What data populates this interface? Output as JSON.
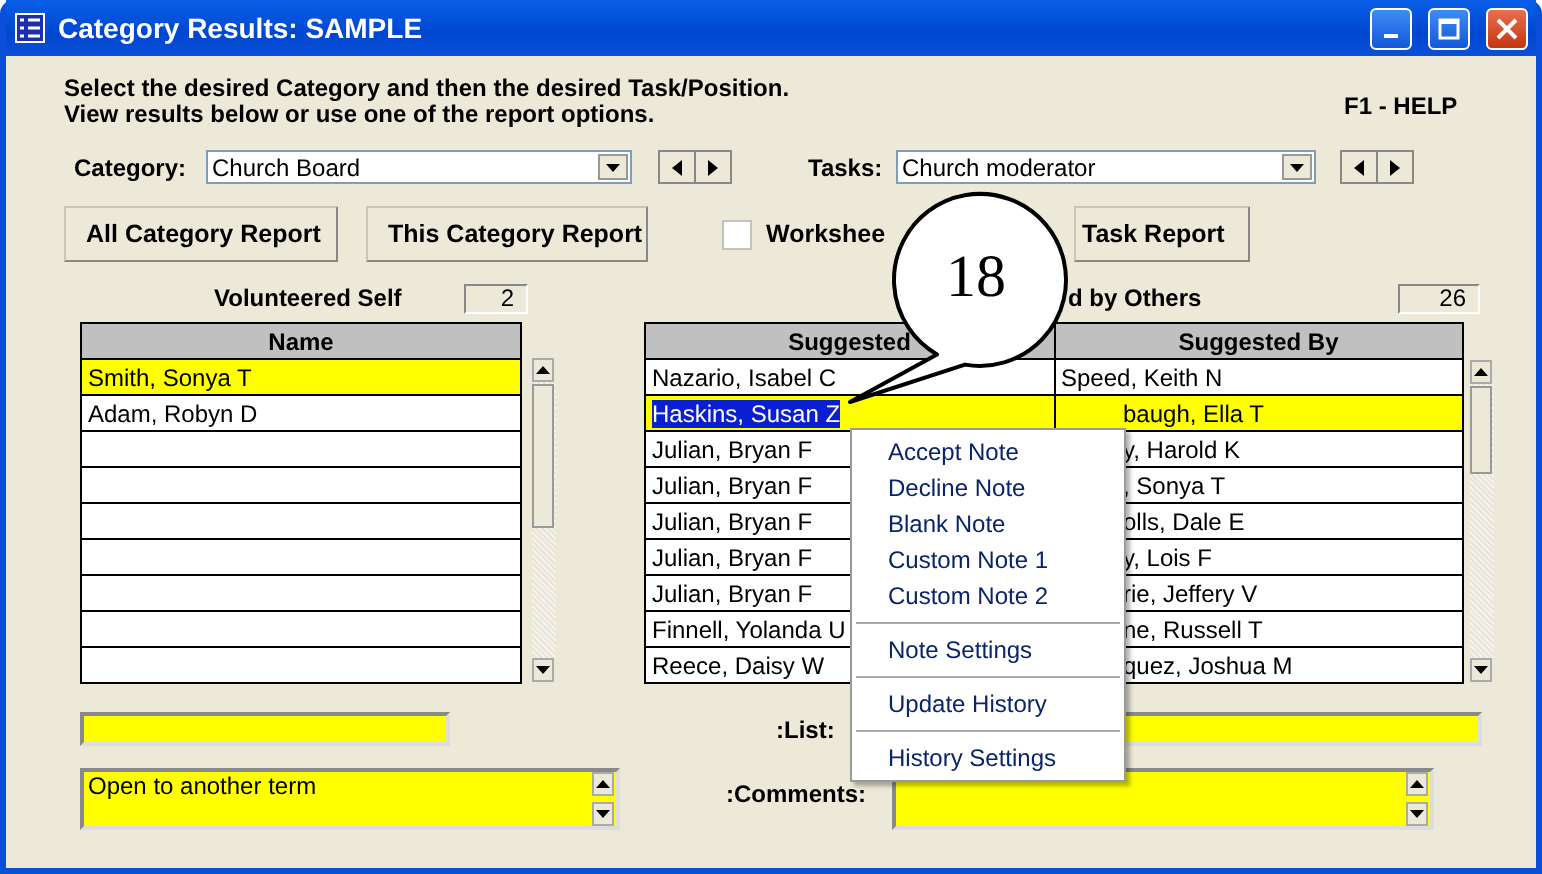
{
  "window": {
    "title": "Category Results: SAMPLE"
  },
  "instructions": [
    "Select the desired Category and then the desired Task/Position.",
    "View results below or use one of the report options."
  ],
  "help": "F1 - HELP",
  "category": {
    "label": "Category:",
    "value": "Church Board"
  },
  "tasks": {
    "label": "Tasks:",
    "value": "Church moderator"
  },
  "buttons": [
    "All Category Report",
    "This Category Report"
  ],
  "worksheet": {
    "label": "Workshee",
    "checked": false
  },
  "task_report_button": "Task Report",
  "volunteered": {
    "label": "Volunteered Self",
    "count": "2",
    "column": "Name",
    "rows": [
      {
        "name": "Smith, Sonya T",
        "selected": true
      },
      {
        "name": "Adam, Robyn D",
        "selected": false
      }
    ]
  },
  "suggested": {
    "label": "d by Others",
    "count": "26",
    "columns": [
      "Suggested",
      "Suggested By"
    ],
    "rows": [
      {
        "suggested": "Nazario, Isabel C",
        "by": "Speed, Keith N",
        "selected": false
      },
      {
        "suggested": "Haskins, Susan Z",
        "by": "baugh, Ella T",
        "selected": true
      },
      {
        "suggested": "Julian, Bryan F",
        "by": "y, Harold K",
        "selected": false
      },
      {
        "suggested": "Julian, Bryan F",
        "by": ", Sonya T",
        "selected": false
      },
      {
        "suggested": "Julian, Bryan F",
        "by": "olls, Dale E",
        "selected": false
      },
      {
        "suggested": "Julian, Bryan F",
        "by": "y, Lois F",
        "selected": false
      },
      {
        "suggested": "Julian, Bryan F",
        "by": "rie, Jeffery V",
        "selected": false
      },
      {
        "suggested": "Finnell, Yolanda U",
        "by": "ne, Russell T",
        "selected": false
      },
      {
        "suggested": "Reece, Daisy W",
        "by": "quez, Joshua M",
        "selected": false
      }
    ]
  },
  "list": {
    "label": ":List:"
  },
  "comments": {
    "label": ":Comments:",
    "value": "Open to another term"
  },
  "context_menu": {
    "groups": [
      [
        "Accept Note",
        "Decline Note",
        "Blank Note",
        "Custom Note 1",
        "Custom Note 2"
      ],
      [
        "Note Settings"
      ],
      [
        "Update History"
      ],
      [
        "History Settings"
      ]
    ]
  },
  "callout": {
    "label": "18"
  }
}
